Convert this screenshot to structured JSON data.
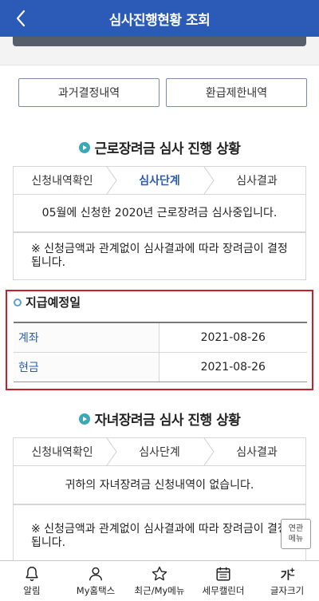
{
  "header": {
    "title": "심사진행현황 조회"
  },
  "buttons": {
    "past": "과거결정내역",
    "refund": "환급제한내역"
  },
  "section1": {
    "title": "근로장려금 심사 진행 상황",
    "steps": [
      "신청내역확인",
      "심사단계",
      "심사결과"
    ],
    "active_step": 1,
    "status": "05월에 신청한 2020년 근로장려금 심사중입니다.",
    "note": "※ 신청금액과 관계없이 심사결과에 따라 장려금이 결정됩니다."
  },
  "payment": {
    "title": "지급예정일",
    "rows": [
      {
        "label": "계좌",
        "date": "2021-08-26"
      },
      {
        "label": "현금",
        "date": "2021-08-26"
      }
    ]
  },
  "section2": {
    "title": "자녀장려금 심사 진행 상황",
    "steps": [
      "신청내역확인",
      "심사단계",
      "심사결과"
    ],
    "status": "귀하의 자녀장려금 신청내역이 없습니다.",
    "note": "※ 신청금액과 관계없이 심사결과에 따라 장려금이 결정됩니다."
  },
  "float_button": {
    "line1": "연관",
    "line2": "메뉴"
  },
  "nav": [
    {
      "label": "알림",
      "icon": "bell-icon"
    },
    {
      "label": "My홈택스",
      "icon": "person-icon"
    },
    {
      "label": "최근/My메뉴",
      "icon": "star-icon"
    },
    {
      "label": "세무캘린더",
      "icon": "calendar-icon"
    },
    {
      "label": "글자크기",
      "icon": "font-size-icon"
    }
  ],
  "colors": {
    "primary": "#2b5bb7",
    "highlight_border": "#c8202b",
    "accent": "#3aa8b5"
  }
}
